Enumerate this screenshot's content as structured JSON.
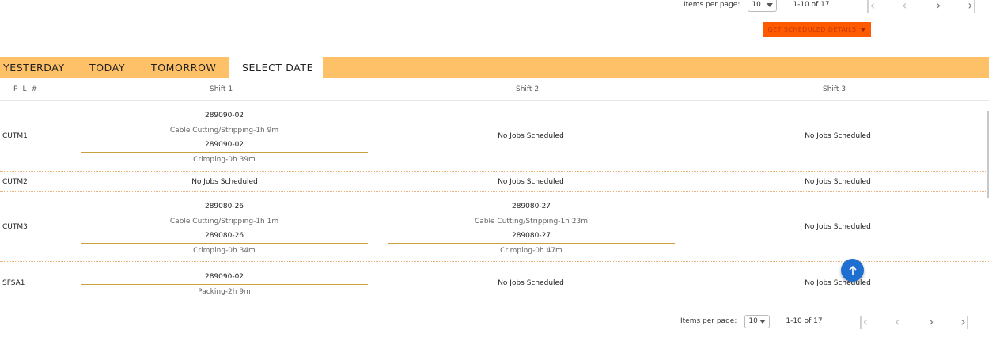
{
  "paginator_top": {
    "items_per_page_label": "Items per page:",
    "page_size": "10",
    "range": "1-10 of 17",
    "icons": {
      "first": "first-page-icon",
      "prev": "prev-page-icon",
      "next": "next-page-icon",
      "last": "last-page-icon"
    }
  },
  "paginator_bottom": {
    "items_per_page_label": "Items per page:",
    "page_size": "10",
    "range": "1-10 of 17"
  },
  "schedule_button": {
    "label": "GET SCHEDULED DETAILS",
    "color": "#ff5a00"
  },
  "tabs": [
    {
      "label": "YESTERDAY",
      "active": false
    },
    {
      "label": "TODAY",
      "active": false
    },
    {
      "label": "TOMORROW",
      "active": false
    },
    {
      "label": "SELECT DATE",
      "active": true
    }
  ],
  "accent_color": "#ffc168",
  "table": {
    "headers": [
      "P L #",
      "Shift 1",
      "Shift 2",
      "Shift 3"
    ],
    "no_jobs": "No Jobs Scheduled",
    "rows": [
      {
        "pl": "CUTM1",
        "shift1": [
          {
            "id": "289090-02",
            "task": "Cable Cutting/Stripping-1h 9m"
          },
          {
            "id": "289090-02",
            "task": "Crimping-0h 39m"
          }
        ]
      },
      {
        "pl": "CUTM2"
      },
      {
        "pl": "CUTM3",
        "shift1": [
          {
            "id": "289080-26",
            "task": "Cable Cutting/Stripping-1h 1m"
          },
          {
            "id": "289080-26",
            "task": "Crimping-0h 34m"
          }
        ],
        "shift2": [
          {
            "id": "289080-27",
            "task": "Cable Cutting/Stripping-1h 23m"
          },
          {
            "id": "289080-27",
            "task": "Crimping-0h 47m"
          }
        ]
      },
      {
        "pl": "SFSA1",
        "shift1": [
          {
            "id": "289090-02",
            "task": "Packing-2h 9m"
          }
        ]
      }
    ]
  },
  "fab": {
    "icon": "arrow-up-icon"
  }
}
